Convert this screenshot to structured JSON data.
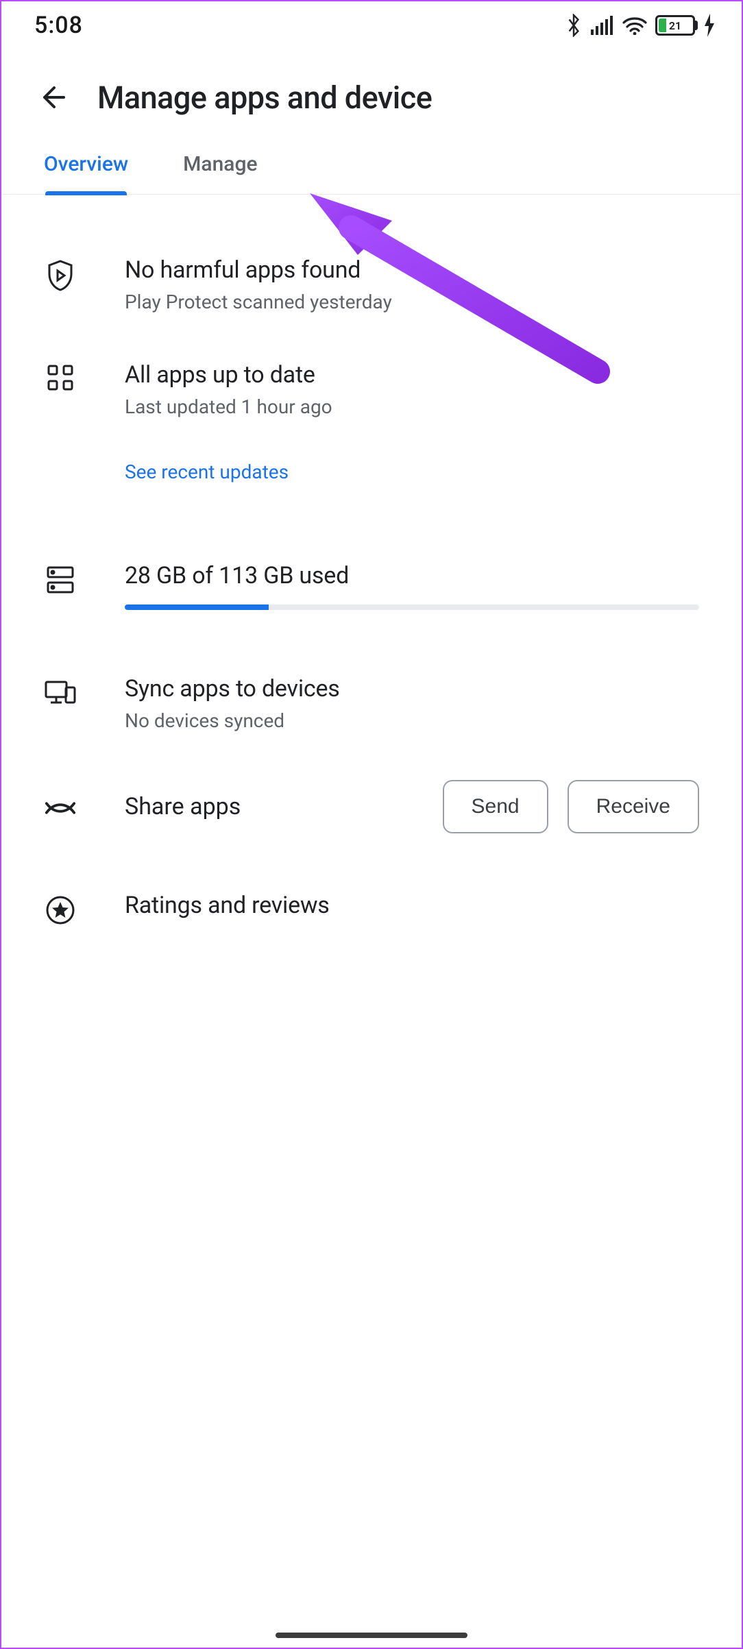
{
  "statusbar": {
    "time": "5:08",
    "battery_percent": "21"
  },
  "header": {
    "title": "Manage apps and device"
  },
  "tabs": {
    "overview": "Overview",
    "manage": "Manage"
  },
  "protect": {
    "title": "No harmful apps found",
    "subtitle": "Play Protect scanned yesterday"
  },
  "updates": {
    "title": "All apps up to date",
    "subtitle": "Last updated 1 hour ago",
    "link": "See recent updates"
  },
  "storage": {
    "title": "28 GB of 113 GB used",
    "used_fraction": 0.25
  },
  "sync": {
    "title": "Sync apps to devices",
    "subtitle": "No devices synced"
  },
  "share": {
    "title": "Share apps",
    "send": "Send",
    "receive": "Receive"
  },
  "ratings": {
    "title": "Ratings and reviews"
  }
}
